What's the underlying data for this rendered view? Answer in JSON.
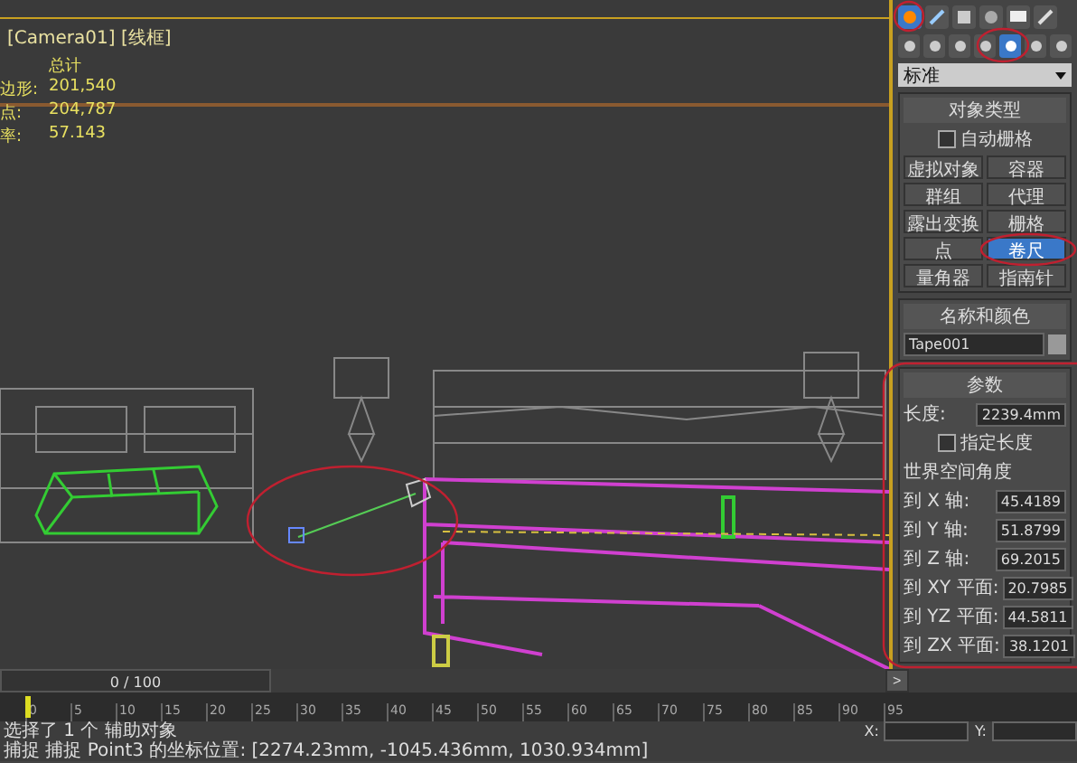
{
  "viewport": {
    "label": "[Camera01] [线框]",
    "stats_title": "总计",
    "stats": [
      {
        "label": "边形:",
        "value": "201,540"
      },
      {
        "label": "点:",
        "value": "204,787"
      },
      {
        "label": "率:",
        "value": "57.143"
      }
    ]
  },
  "command_panel": {
    "tabs": [
      {
        "selected": true
      },
      {
        "selected": false
      },
      {
        "selected": false
      },
      {
        "selected": false
      },
      {
        "selected": false
      },
      {
        "selected": false
      }
    ],
    "subtabs": [
      {
        "selected": false
      },
      {
        "selected": false
      },
      {
        "selected": false
      },
      {
        "selected": false
      },
      {
        "selected": true
      },
      {
        "selected": false
      },
      {
        "selected": false
      }
    ],
    "dropdown": "标准",
    "object_type": {
      "title": "对象类型",
      "autogrid": {
        "label": "自动栅格",
        "checked": false
      },
      "buttons": [
        {
          "label": "虚拟对象",
          "selected": false
        },
        {
          "label": "容器",
          "selected": false
        },
        {
          "label": "群组",
          "selected": false
        },
        {
          "label": "代理",
          "selected": false
        },
        {
          "label": "露出变换",
          "selected": false
        },
        {
          "label": "栅格",
          "selected": false
        },
        {
          "label": "点",
          "selected": false
        },
        {
          "label": "卷尺",
          "selected": true
        },
        {
          "label": "量角器",
          "selected": false
        },
        {
          "label": "指南针",
          "selected": false
        }
      ]
    },
    "name_color": {
      "title": "名称和颜色",
      "name": "Tape001"
    },
    "parameters": {
      "title": "参数",
      "length_label": "长度:",
      "length_value": "2239.4mm",
      "specify_length": {
        "label": "指定长度",
        "checked": false
      },
      "group_title": "世界空间角度",
      "angles": [
        {
          "label": "到 X 轴:",
          "value": "45.4189"
        },
        {
          "label": "到 Y 轴:",
          "value": "51.8799"
        },
        {
          "label": "到 Z 轴:",
          "value": "69.2015"
        },
        {
          "label": "到 XY 平面:",
          "value": "20.7985"
        },
        {
          "label": "到 YZ 平面:",
          "value": "44.5811"
        },
        {
          "label": "到 ZX 平面:",
          "value": "38.1201"
        }
      ]
    }
  },
  "timeline": {
    "frame": "0 / 100",
    "level": 0,
    "next": ">",
    "ticks": [
      "0",
      "5",
      "10",
      "15",
      "20",
      "25",
      "30",
      "35",
      "40",
      "45",
      "50",
      "55",
      "60",
      "65",
      "70",
      "75",
      "80",
      "85",
      "90",
      "95"
    ]
  },
  "status": {
    "selection": "选择了 1 个 辅助对象",
    "prompt": "捕捉 捕捉 Point3 的坐标位置: [2274.23mm, -1045.436mm, 1030.934mm]",
    "x_label": "X:",
    "y_label": "Y:"
  }
}
